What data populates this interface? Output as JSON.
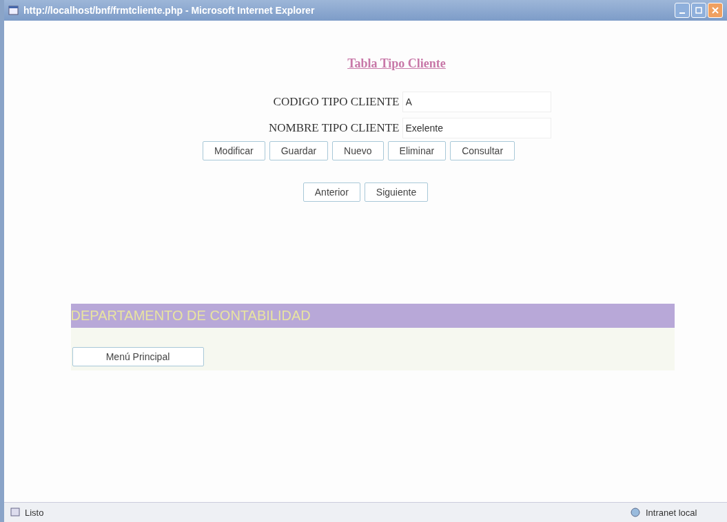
{
  "window": {
    "title": "http://localhost/bnf/frmtcliente.php - Microsoft Internet Explorer"
  },
  "heading": "Tabla Tipo Cliente",
  "fields": [
    {
      "label": "CODIGO TIPO CLIENTE",
      "value": "A"
    },
    {
      "label": "NOMBRE TIPO CLIENTE",
      "value": "Exelente"
    }
  ],
  "actions": [
    "Modificar",
    "Guardar",
    "Nuevo",
    "Eliminar",
    "Consultar"
  ],
  "navigation": [
    "Anterior",
    "Siguiente"
  ],
  "banner": "DEPARTAMENTO DE CONTABILIDAD",
  "menu_button": "Menú Principal",
  "status_bar": {
    "status": "Listo",
    "zone": "Intranet local"
  }
}
